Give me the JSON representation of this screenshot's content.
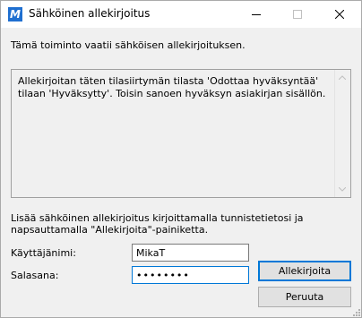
{
  "window": {
    "title": "Sähköinen allekirjoitus",
    "app_icon_letter": "M"
  },
  "content": {
    "intro": "Tämä toiminto vaatii sähköisen allekirjoituksen.",
    "message": "Allekirjoitan täten tilasiirtymän tilasta 'Odottaa hyväksyntää' tilaan 'Hyväksytty'. Toisin sanoen hyväksyn asiakirjan sisällön.",
    "instructions": "Lisää sähköinen allekirjoitus kirjoittamalla tunnistetietosi ja napsauttamalla \"Allekirjoita\"-painiketta."
  },
  "form": {
    "username_label": "Käyttäjänimi:",
    "username_value": "MikaT",
    "password_label": "Salasana:",
    "password_value": "••••••••"
  },
  "buttons": {
    "sign": "Allekirjoita",
    "cancel": "Peruuta"
  },
  "colors": {
    "accent": "#0078d7",
    "app_icon": "#1f6fd0"
  }
}
